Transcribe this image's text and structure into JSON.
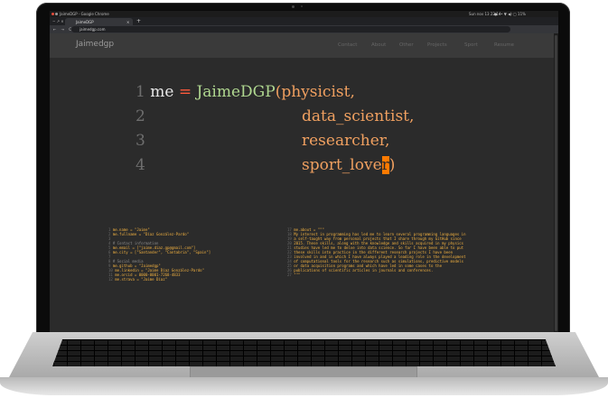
{
  "os": {
    "app_title": "JaimeDGP - Google Chrome",
    "clock": "Sun nov 13  22:14",
    "tray": "●  ••  ▼  ◀)  ▢ 11%"
  },
  "browser": {
    "tab_title": "JaimeDGP",
    "tab_close": "×",
    "new_tab": "+",
    "window_controls": "−  ↗  ×",
    "nav_buttons": "← → C",
    "url": "jaimedgp.com",
    "colors": {
      "ext1": "#e53935",
      "ext2": "#43a047",
      "ext3": "#1e88e5",
      "ext4": "#fbc02d"
    }
  },
  "site": {
    "brand": "Jaimedgp",
    "menu": [
      "Contact",
      "About",
      "Other",
      "Projects",
      "Sport",
      "Resume"
    ]
  },
  "hero": {
    "lines": [
      {
        "num": "1",
        "a": "me",
        "b": "=",
        "c": "JaimeDGP",
        "d": "(physicist,"
      },
      {
        "num": "2",
        "d": "data_scientist,"
      },
      {
        "num": "3",
        "d": "researcher,"
      },
      {
        "num": "4",
        "d": "sport_love",
        "cursor": "r",
        "tail": ")"
      }
    ]
  },
  "left_code": [
    {
      "n": "1",
      "text": "me.name = \"Jaime\""
    },
    {
      "n": "2",
      "text": "me.fullname = \"Díaz González-Pardo\""
    },
    {
      "n": "3",
      "text": ""
    },
    {
      "n": "4",
      "text": "# Contact information"
    },
    {
      "n": "5",
      "text": "me.email = [\"jaime.diaz.gp@gmail.com\"]"
    },
    {
      "n": "6",
      "text": "me.city = [\"Santander\", \"Cantabria\", \"Spain\"]"
    },
    {
      "n": "7",
      "text": ""
    },
    {
      "n": "8",
      "text": "# Social media"
    },
    {
      "n": "9",
      "text": "me.github = \"Jaimedgp\""
    },
    {
      "n": "10",
      "text": "me.linkedin = \"Jaime Díaz González-Pardo\""
    },
    {
      "n": "11",
      "text": "me.orcid = 0000-0001-7268-4833"
    },
    {
      "n": "12",
      "text": "me.strava = \"Jaime Díaz\""
    }
  ],
  "right_code": [
    {
      "n": "17",
      "text": "me.about = \"\"\""
    },
    {
      "n": "18",
      "text": "My interest in programming has led me to learn several programming languages in"
    },
    {
      "n": "19",
      "text": "a self-taught way from personal projects that I share through my GitHub since"
    },
    {
      "n": "20",
      "text": "2015. These skills, along with the knowledge and skills acquired in my physics"
    },
    {
      "n": "21",
      "text": "studies have led me to delve into data science. So far I have been able to put"
    },
    {
      "n": "22",
      "text": "these skills into practice in the different research projects I have been"
    },
    {
      "n": "23",
      "text": "involved in and in which I have always played a leading role in the development"
    },
    {
      "n": "24",
      "text": "of computational tools for the research such as simulations, predictive models"
    },
    {
      "n": "25",
      "text": "or data acquisition programs and which have led in some cases to the"
    },
    {
      "n": "26",
      "text": "publications of scientific articles in journals and conferences."
    },
    {
      "n": "27",
      "text": "\"\"\""
    }
  ]
}
